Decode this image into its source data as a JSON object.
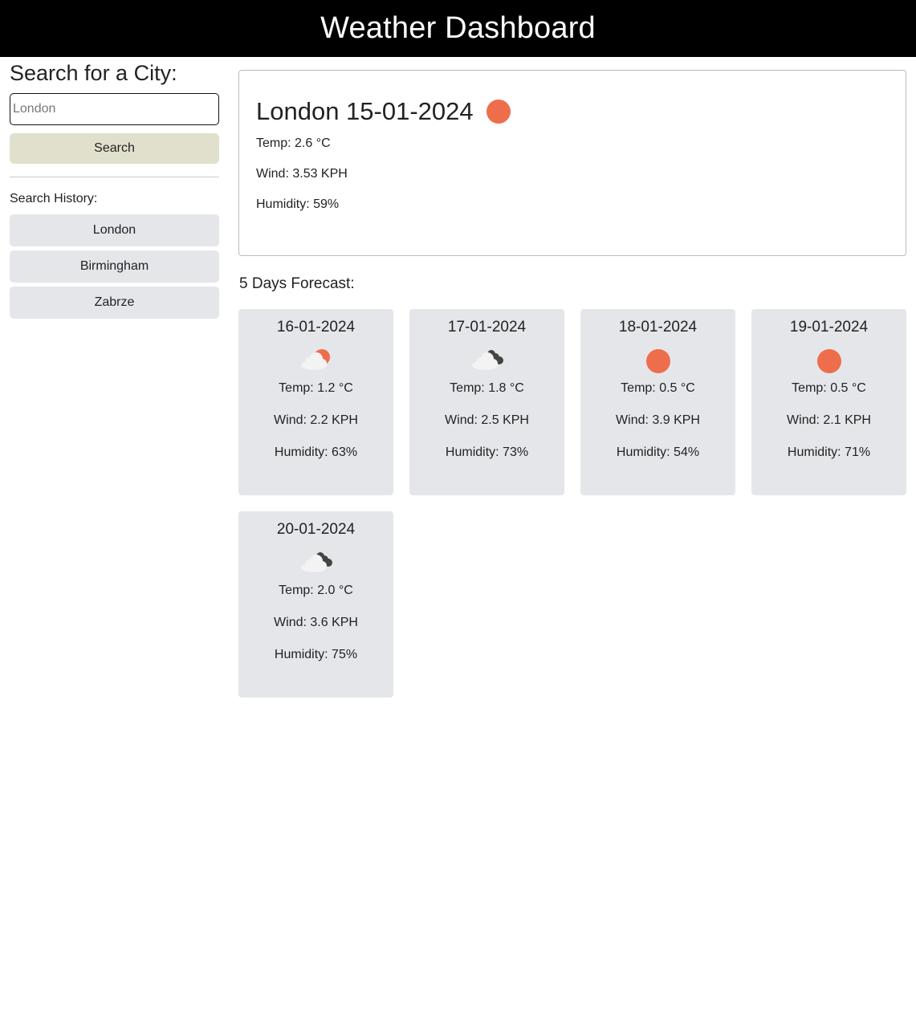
{
  "header": {
    "title": "Weather Dashboard"
  },
  "sidebar": {
    "heading": "Search for a City:",
    "search_placeholder": "London",
    "search_button": "Search",
    "history_label": "Search History:",
    "history": [
      "London",
      "Birmingham",
      "Zabrze"
    ]
  },
  "current": {
    "title": "London 15-01-2024",
    "icon": "sun-icon",
    "temp": "Temp: 2.6 °C",
    "wind": "Wind: 3.53 KPH",
    "humidity": "Humidity: 59%"
  },
  "forecast": {
    "label": "5 Days Forecast:",
    "days": [
      {
        "date": "16-01-2024",
        "icon": "partly-cloudy-icon",
        "temp": "Temp: 1.2 °C",
        "wind": "Wind: 2.2 KPH",
        "humidity": "Humidity: 63%"
      },
      {
        "date": "17-01-2024",
        "icon": "cloudy-icon",
        "temp": "Temp: 1.8 °C",
        "wind": "Wind: 2.5 KPH",
        "humidity": "Humidity: 73%"
      },
      {
        "date": "18-01-2024",
        "icon": "sun-icon",
        "temp": "Temp: 0.5 °C",
        "wind": "Wind: 3.9 KPH",
        "humidity": "Humidity: 54%"
      },
      {
        "date": "19-01-2024",
        "icon": "sun-icon",
        "temp": "Temp: 0.5 °C",
        "wind": "Wind: 2.1 KPH",
        "humidity": "Humidity: 71%"
      },
      {
        "date": "20-01-2024",
        "icon": "cloudy-icon",
        "temp": "Temp: 2.0 °C",
        "wind": "Wind: 3.6 KPH",
        "humidity": "Humidity: 75%"
      }
    ]
  },
  "colors": {
    "header_bg": "#000000",
    "sun": "#ee6e4c",
    "card_bg": "#e5e6ea",
    "search_button_bg": "#e0e0cd"
  }
}
